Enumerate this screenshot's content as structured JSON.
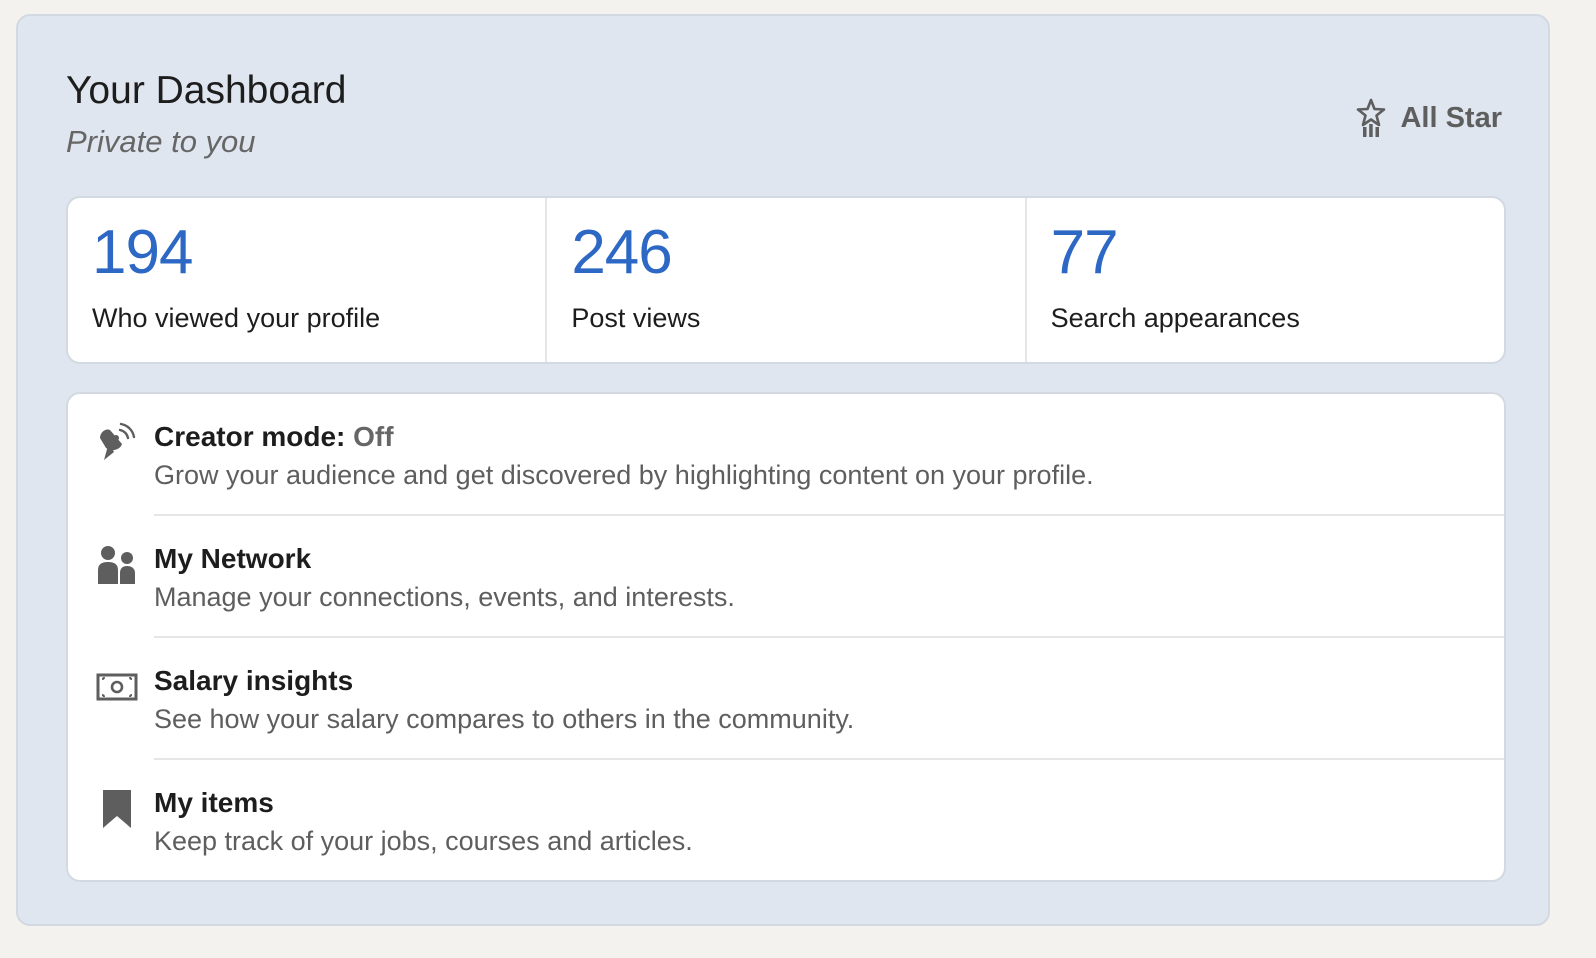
{
  "header": {
    "title": "Your Dashboard",
    "subtitle": "Private to you"
  },
  "badge": {
    "icon": "all-star-icon",
    "label": "All Star"
  },
  "stats": [
    {
      "value": "194",
      "label": "Who viewed your profile"
    },
    {
      "value": "246",
      "label": "Post views"
    },
    {
      "value": "77",
      "label": "Search appearances"
    }
  ],
  "features": [
    {
      "icon": "creator-mode-icon",
      "title": "Creator mode:",
      "status": "Off",
      "description": "Grow your audience and get discovered by highlighting content on your profile."
    },
    {
      "icon": "network-icon",
      "title": "My Network",
      "description": "Manage your connections, events, and interests."
    },
    {
      "icon": "salary-icon",
      "title": "Salary insights",
      "description": "See how your salary compares to others in the community."
    },
    {
      "icon": "bookmark-icon",
      "title": "My items",
      "description": "Keep track of your jobs, courses and articles."
    }
  ],
  "colors": {
    "accent": "#2d68c4",
    "card_bg": "#dfe6ef",
    "panel_bg": "#ffffff",
    "icon": "#5e5e5e"
  }
}
